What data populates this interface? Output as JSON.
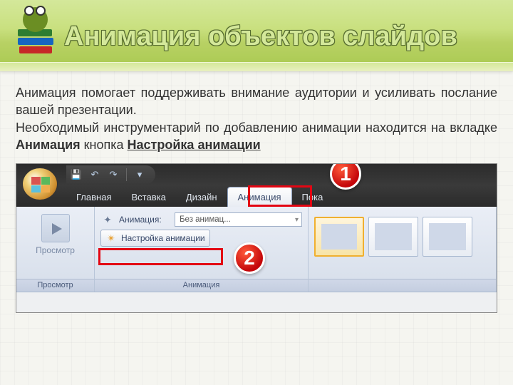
{
  "slide": {
    "title": "Анимация объектов слайдов",
    "paragraph_part1": "Анимация помогает поддерживать внимание аудитории и усиливать послание вашей презентации.",
    "paragraph_part2a": "Необходимый инструментарий по добавлению анимации находится на вкладке ",
    "paragraph_bold1": "Анимация",
    "paragraph_part2b": " кнопка ",
    "paragraph_bold2": "Настройка анимации"
  },
  "callouts": {
    "one": "1",
    "two": "2"
  },
  "ribbon": {
    "tabs": [
      "Главная",
      "Вставка",
      "Дизайн",
      "Анимация",
      "Пока"
    ],
    "active_index": 3,
    "groups": {
      "preview": {
        "label": "Просмотр",
        "title": "Просмотр"
      },
      "animation": {
        "title": "Анимация",
        "row_label": "Анимация:",
        "row_value": "Без анимац...",
        "custom_btn": "Настройка анимации"
      }
    }
  }
}
